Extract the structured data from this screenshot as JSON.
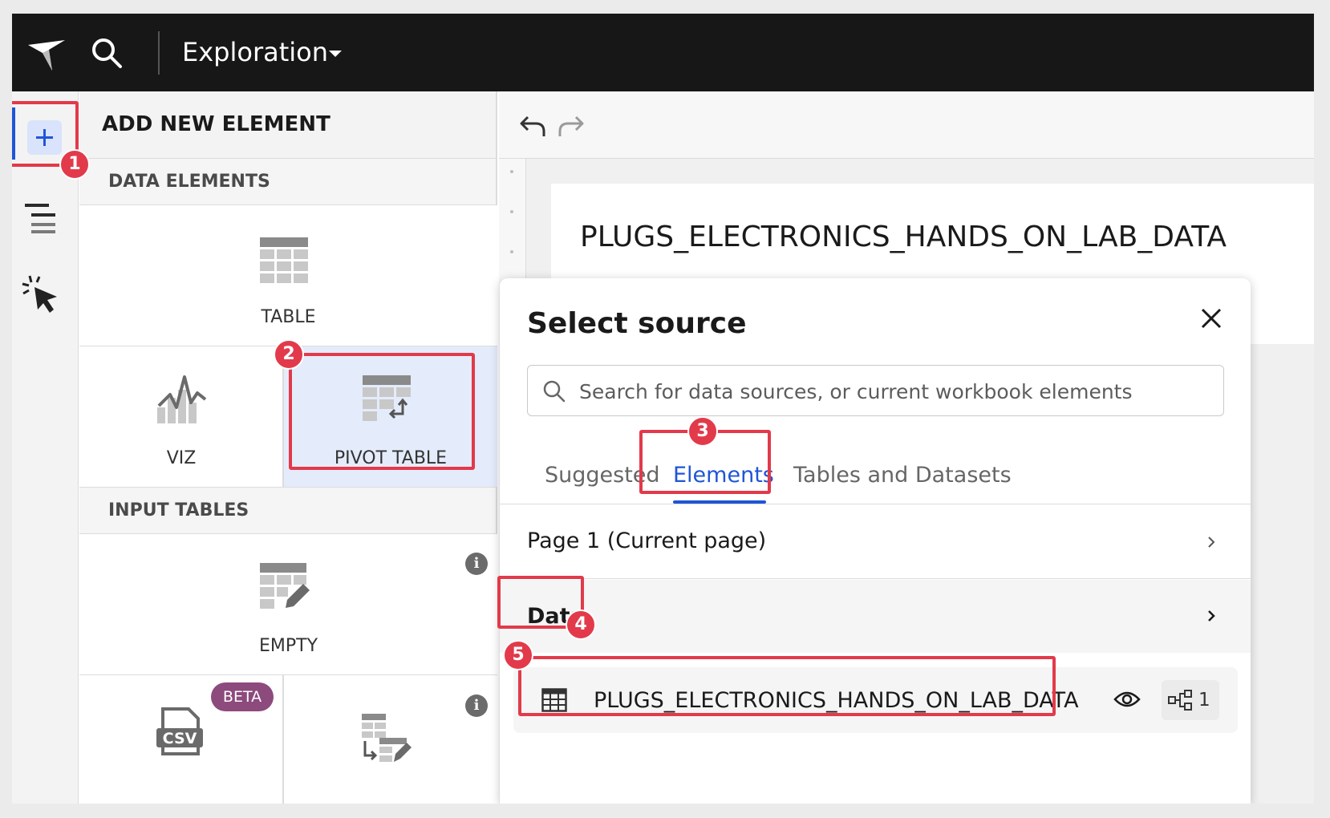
{
  "header": {
    "title": "Exploration",
    "logo_icon": "sigma-logo-icon",
    "search_icon": "search-icon"
  },
  "rail": {
    "items": [
      "add-element-icon",
      "layers-icon",
      "interactions-icon"
    ]
  },
  "panel": {
    "title": "ADD NEW ELEMENT",
    "data_elements": {
      "label": "DATA ELEMENTS",
      "tiles": [
        {
          "label": "TABLE",
          "icon": "table-icon"
        },
        {
          "label": "VIZ",
          "icon": "viz-icon"
        },
        {
          "label": "PIVOT TABLE",
          "icon": "pivot-table-icon"
        }
      ]
    },
    "input_tables": {
      "label": "INPUT TABLES",
      "tiles": [
        {
          "label": "EMPTY",
          "icon": "empty-input-table-icon"
        },
        {
          "label": "CSV",
          "icon": "csv-icon",
          "badge": "BETA"
        },
        {
          "label": "",
          "icon": "linked-input-table-icon"
        }
      ]
    }
  },
  "canvas": {
    "heading": "PLUGS_ELECTRONICS_HANDS_ON_LAB_DATA"
  },
  "modal": {
    "title": "Select source",
    "search": {
      "placeholder": "Search for data sources, or current workbook elements"
    },
    "tabs": [
      {
        "label": "Suggested",
        "active": false
      },
      {
        "label": "Elements",
        "active": true
      },
      {
        "label": "Tables and Datasets",
        "active": false
      }
    ],
    "rows": [
      {
        "label": "Page 1 (Current page)"
      },
      {
        "label": "Data"
      }
    ],
    "item": {
      "label": "PLUGS_ELECTRONICS_HANDS_ON_LAB_DATA",
      "lineage_count": "1"
    }
  },
  "callouts": [
    "1",
    "2",
    "3",
    "4",
    "5"
  ],
  "colors": {
    "accent": "#1f55d6",
    "highlight": "#e23a4a",
    "topbar": "#171717",
    "beta": "#8c4a7d"
  }
}
